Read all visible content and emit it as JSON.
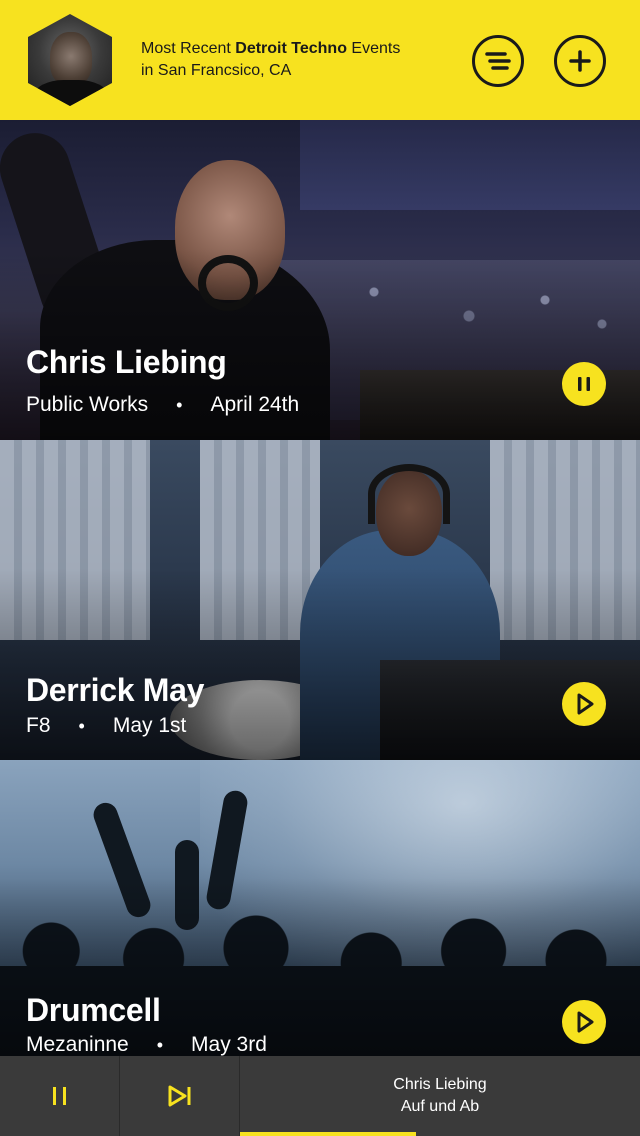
{
  "header": {
    "prefix": "Most Recent",
    "genre": "Detroit Techno",
    "suffix": "Events",
    "location": "in San Francsico, CA"
  },
  "events": [
    {
      "artist": "Chris Liebing",
      "venue": "Public Works",
      "date": "April 24th",
      "state": "pause"
    },
    {
      "artist": "Derrick May",
      "venue": "F8",
      "date": "May 1st",
      "state": "play"
    },
    {
      "artist": "Drumcell",
      "venue": "Mezaninne",
      "date": "May 3rd",
      "state": "play"
    }
  ],
  "player": {
    "track_artist": "Chris Liebing",
    "track_title": "Auf und Ab",
    "progress": 0.44
  },
  "colors": {
    "accent": "#f7e21f",
    "player_bg": "#3a3a3a",
    "dark": "#1a1a1a"
  },
  "separator": "•"
}
